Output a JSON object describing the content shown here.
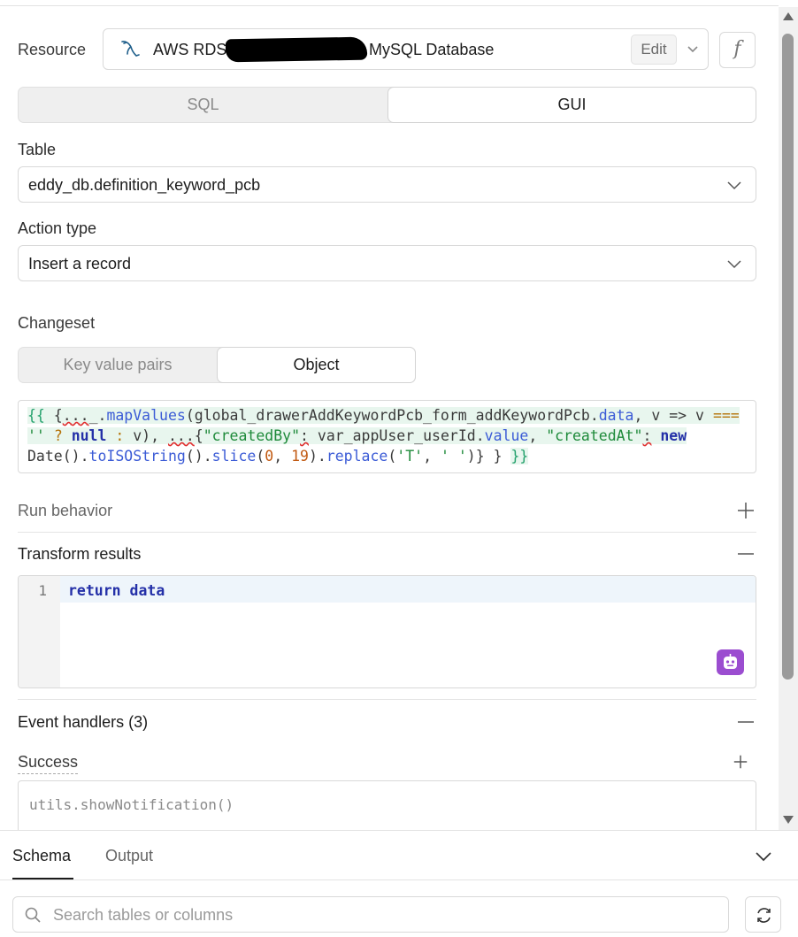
{
  "resource": {
    "label": "Resource",
    "prefix": "AWS RDS",
    "suffix": "MySQL Database",
    "icon": "mysql-dolphin-icon",
    "edit_label": "Edit",
    "fx_label": "f"
  },
  "mode_toggle": {
    "options": [
      "SQL",
      "GUI"
    ],
    "selected": "GUI"
  },
  "table": {
    "label": "Table",
    "value": "eddy_db.definition_keyword_pcb"
  },
  "action_type": {
    "label": "Action type",
    "value": "Insert a record"
  },
  "changeset": {
    "label": "Changeset",
    "options": [
      "Key value pairs",
      "Object"
    ],
    "selected": "Object",
    "code_lines": [
      "{{ {..._.mapValues(global_drawerAddKeywordPcb_form_addKeywordPcb.data, v => v ===",
      "'' ? null : v), ...{\"createdBy\": var_appUser_userId.value, \"createdAt\": new",
      "Date().toISOString().slice(0, 19).replace('T', ' ')} } }}"
    ]
  },
  "run_behavior": {
    "label": "Run behavior"
  },
  "transform_results": {
    "label": "Transform results",
    "line_number": "1",
    "code": "return data"
  },
  "event_handlers": {
    "label": "Event handlers (3)",
    "success_label": "Success",
    "success_placeholder": "utils.showNotification()"
  },
  "bottom_panel": {
    "tabs": [
      "Schema",
      "Output"
    ],
    "active_tab": "Schema",
    "search_placeholder": "Search tables or columns"
  },
  "colors": {
    "accent_ai": "#9b4dd0",
    "code_brace": "#22a06b",
    "code_function": "#3b5bd6",
    "code_string": "#1e8a3a",
    "code_number": "#c15a12",
    "code_keyword": "#2430a8"
  }
}
